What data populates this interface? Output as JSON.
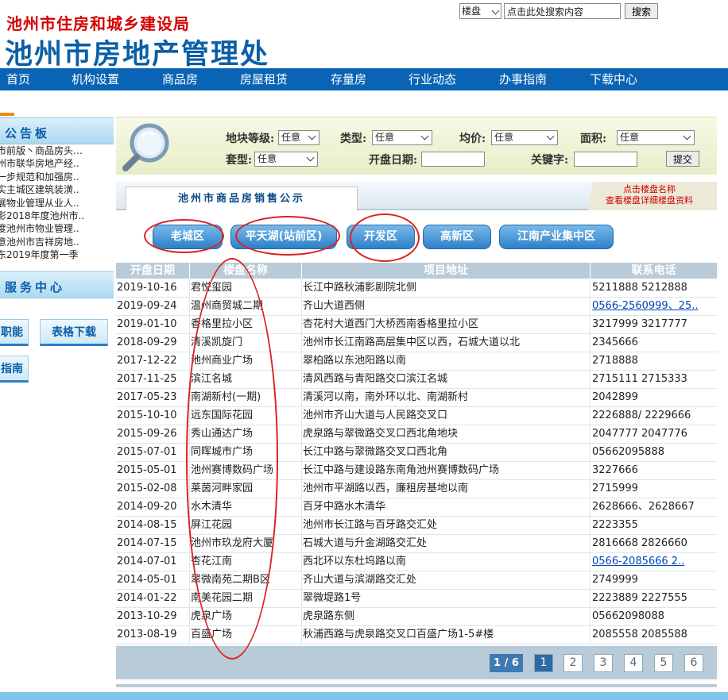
{
  "header": {
    "org": "池州市住房和城乡建设局",
    "title": "池州市房地产管理处",
    "search": {
      "type_value": "楼盘",
      "input_value": "点击此处搜索内容",
      "button": "搜索"
    }
  },
  "nav": [
    "首页",
    "机构设置",
    "商品房",
    "房屋租赁",
    "存量房",
    "行业动态",
    "办事指南",
    "下载中心"
  ],
  "sidebar": {
    "notice_title": "公告板",
    "notices": [
      "市前版丶商品房头…",
      "州市联华房地产经..",
      "一步规范和加强房..",
      "实主城区建筑装潢..",
      "展物业管理从业人..",
      "影2018年度池州市..",
      "度池州市物业管理..",
      "意池州市吉祥房地..",
      "东2019年度第一季"
    ],
    "service_title": "服务中心",
    "services": [
      "职能",
      "表格下载",
      "指南"
    ]
  },
  "filter": {
    "labels": {
      "land_grade": "地块等级:",
      "type": "类型:",
      "avg_price": "均价:",
      "area": "面积:",
      "layout": "套型:",
      "open_date": "开盘日期:",
      "keyword": "关键字:"
    },
    "any": "任意",
    "submit": "提交"
  },
  "sales": {
    "tab": "池州市商品房销售公示",
    "hint_line1": "点击楼盘名称",
    "hint_line2": "查看楼盘详细楼盘资料"
  },
  "areas": [
    "老城区",
    "平天湖(站前区)",
    "开发区",
    "高新区",
    "江南产业集中区"
  ],
  "table": {
    "headers": [
      "开盘日期",
      "楼盘名称",
      "项目地址",
      "联系电话"
    ],
    "rows": [
      {
        "date": "2019-10-16",
        "name": "君悦玺园",
        "addr": "长江中路秋浦影剧院北侧",
        "phone": "5211888 5212888",
        "link": false
      },
      {
        "date": "2019-09-24",
        "name": "温州商贸城二期",
        "addr": "齐山大道西侧",
        "phone": "0566-2560999、25..",
        "link": true
      },
      {
        "date": "2019-01-10",
        "name": "香格里拉小区",
        "addr": "杏花村大道西门大桥西南香格里拉小区",
        "phone": "3217999 3217777",
        "link": false
      },
      {
        "date": "2018-09-29",
        "name": "清溪凯旋门",
        "addr": "池州市长江南路高层集中区以西，石城大道以北",
        "phone": "2345666",
        "link": false
      },
      {
        "date": "2017-12-22",
        "name": "池州商业广场",
        "addr": "翠柏路以东池阳路以南",
        "phone": "2718888",
        "link": false
      },
      {
        "date": "2017-11-25",
        "name": "滨江名城",
        "addr": "清风西路与青阳路交口滨江名城",
        "phone": "2715111 2715333",
        "link": false
      },
      {
        "date": "2017-05-23",
        "name": "南湖新村(一期)",
        "addr": "清溪河以南，南外环以北、南湖新村",
        "phone": "2042899",
        "link": false
      },
      {
        "date": "2015-10-10",
        "name": "远东国际花园",
        "addr": "池州市齐山大道与人民路交叉口",
        "phone": "2226888/ 2229666",
        "link": false
      },
      {
        "date": "2015-09-26",
        "name": "秀山通达广场",
        "addr": "虎泉路与翠微路交叉口西北角地块",
        "phone": "2047777 2047776",
        "link": false
      },
      {
        "date": "2015-07-01",
        "name": "同晖城市广场",
        "addr": "长江中路与翠微路交叉口西北角",
        "phone": "05662095888",
        "link": false
      },
      {
        "date": "2015-05-01",
        "name": "池州赛博数码广场",
        "addr": "长江中路与建设路东南角池州赛博数码广场",
        "phone": "3227666",
        "link": false
      },
      {
        "date": "2015-02-08",
        "name": "莱茵河畔家园",
        "addr": "池州市平湖路以西，廉租房基地以南",
        "phone": "2715999",
        "link": false
      },
      {
        "date": "2014-09-20",
        "name": "水木清华",
        "addr": "百牙中路水木清华",
        "phone": "2628666、2628667",
        "link": false
      },
      {
        "date": "2014-08-15",
        "name": "屏江花园",
        "addr": "池州市长江路与百牙路交汇处",
        "phone": "2223355",
        "link": false
      },
      {
        "date": "2014-07-15",
        "name": "池州市玖龙府大厦",
        "addr": "石城大道与升金湖路交汇处",
        "phone": "2816668 2826660",
        "link": false
      },
      {
        "date": "2014-07-01",
        "name": "杏花江南",
        "addr": "西北环以东杜坞路以南",
        "phone": "0566-2085666 2..",
        "link": true
      },
      {
        "date": "2014-05-01",
        "name": "翠微南苑二期B区",
        "addr": "齐山大道与滨湖路交汇处",
        "phone": "2749999",
        "link": false
      },
      {
        "date": "2014-01-22",
        "name": "南美花园二期",
        "addr": "翠微堤路1号",
        "phone": "2223889 2227555",
        "link": false
      },
      {
        "date": "2013-10-29",
        "name": "虎泉广场",
        "addr": "虎泉路东侧",
        "phone": "05662098088",
        "link": false
      },
      {
        "date": "2013-08-19",
        "name": "百盛广场",
        "addr": "秋浦西路与虎泉路交叉口百盛广场1-5#楼",
        "phone": "2085558 2085588",
        "link": false
      }
    ]
  },
  "pager": {
    "indicator": "1 / 6",
    "pages": [
      "1",
      "2",
      "3",
      "4",
      "5",
      "6"
    ],
    "current": "1"
  },
  "colors": {
    "brand_blue": "#0a64b5",
    "header_red": "#d40000",
    "table_header": "#b9cbd8",
    "annotation_red": "#dd2222"
  }
}
